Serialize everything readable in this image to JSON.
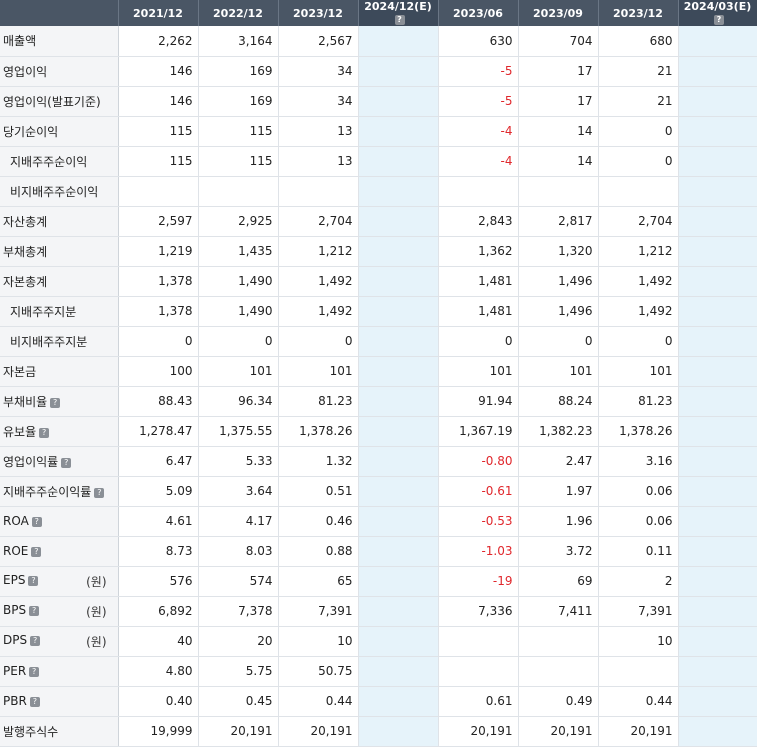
{
  "headers": [
    "",
    "2021/12",
    "2022/12",
    "2023/12",
    "2024/12(E)",
    "2023/06",
    "2023/09",
    "2023/12",
    "2024/03(E)"
  ],
  "estimate_columns": [
    4,
    8
  ],
  "rows": [
    {
      "label": "매출액",
      "help": false,
      "unit": "",
      "sub": false,
      "values": [
        "2,262",
        "3,164",
        "2,567",
        "",
        "630",
        "704",
        "680",
        ""
      ]
    },
    {
      "label": "영업이익",
      "help": false,
      "unit": "",
      "sub": false,
      "values": [
        "146",
        "169",
        "34",
        "",
        "-5",
        "17",
        "21",
        ""
      ]
    },
    {
      "label": "영업이익(발표기준)",
      "help": false,
      "unit": "",
      "sub": false,
      "values": [
        "146",
        "169",
        "34",
        "",
        "-5",
        "17",
        "21",
        ""
      ]
    },
    {
      "label": "당기순이익",
      "help": false,
      "unit": "",
      "sub": false,
      "values": [
        "115",
        "115",
        "13",
        "",
        "-4",
        "14",
        "0",
        ""
      ]
    },
    {
      "label": "지배주주순이익",
      "help": false,
      "unit": "",
      "sub": true,
      "values": [
        "115",
        "115",
        "13",
        "",
        "-4",
        "14",
        "0",
        ""
      ]
    },
    {
      "label": "비지배주주순이익",
      "help": false,
      "unit": "",
      "sub": true,
      "values": [
        "",
        "",
        "",
        "",
        "",
        "",
        "",
        ""
      ]
    },
    {
      "label": "자산총계",
      "help": false,
      "unit": "",
      "sub": false,
      "values": [
        "2,597",
        "2,925",
        "2,704",
        "",
        "2,843",
        "2,817",
        "2,704",
        ""
      ]
    },
    {
      "label": "부채총계",
      "help": false,
      "unit": "",
      "sub": false,
      "values": [
        "1,219",
        "1,435",
        "1,212",
        "",
        "1,362",
        "1,320",
        "1,212",
        ""
      ]
    },
    {
      "label": "자본총계",
      "help": false,
      "unit": "",
      "sub": false,
      "values": [
        "1,378",
        "1,490",
        "1,492",
        "",
        "1,481",
        "1,496",
        "1,492",
        ""
      ]
    },
    {
      "label": "지배주주지분",
      "help": false,
      "unit": "",
      "sub": true,
      "values": [
        "1,378",
        "1,490",
        "1,492",
        "",
        "1,481",
        "1,496",
        "1,492",
        ""
      ]
    },
    {
      "label": "비지배주주지분",
      "help": false,
      "unit": "",
      "sub": true,
      "values": [
        "0",
        "0",
        "0",
        "",
        "0",
        "0",
        "0",
        ""
      ]
    },
    {
      "label": "자본금",
      "help": false,
      "unit": "",
      "sub": false,
      "values": [
        "100",
        "101",
        "101",
        "",
        "101",
        "101",
        "101",
        ""
      ]
    },
    {
      "label": "부채비율",
      "help": true,
      "unit": "",
      "sub": false,
      "values": [
        "88.43",
        "96.34",
        "81.23",
        "",
        "91.94",
        "88.24",
        "81.23",
        ""
      ]
    },
    {
      "label": "유보율",
      "help": true,
      "unit": "",
      "sub": false,
      "values": [
        "1,278.47",
        "1,375.55",
        "1,378.26",
        "",
        "1,367.19",
        "1,382.23",
        "1,378.26",
        ""
      ]
    },
    {
      "label": "영업이익률",
      "help": true,
      "unit": "",
      "sub": false,
      "values": [
        "6.47",
        "5.33",
        "1.32",
        "",
        "-0.80",
        "2.47",
        "3.16",
        ""
      ]
    },
    {
      "label": "지배주주순이익률",
      "help": true,
      "unit": "",
      "sub": false,
      "values": [
        "5.09",
        "3.64",
        "0.51",
        "",
        "-0.61",
        "1.97",
        "0.06",
        ""
      ]
    },
    {
      "label": "ROA",
      "help": true,
      "unit": "",
      "sub": false,
      "values": [
        "4.61",
        "4.17",
        "0.46",
        "",
        "-0.53",
        "1.96",
        "0.06",
        ""
      ]
    },
    {
      "label": "ROE",
      "help": true,
      "unit": "",
      "sub": false,
      "values": [
        "8.73",
        "8.03",
        "0.88",
        "",
        "-1.03",
        "3.72",
        "0.11",
        ""
      ]
    },
    {
      "label": "EPS",
      "help": true,
      "unit": "(원)",
      "sub": false,
      "values": [
        "576",
        "574",
        "65",
        "",
        "-19",
        "69",
        "2",
        ""
      ]
    },
    {
      "label": "BPS",
      "help": true,
      "unit": "(원)",
      "sub": false,
      "values": [
        "6,892",
        "7,378",
        "7,391",
        "",
        "7,336",
        "7,411",
        "7,391",
        ""
      ]
    },
    {
      "label": "DPS",
      "help": true,
      "unit": "(원)",
      "sub": false,
      "values": [
        "40",
        "20",
        "10",
        "",
        "",
        "",
        "10",
        ""
      ]
    },
    {
      "label": "PER",
      "help": true,
      "unit": "",
      "sub": false,
      "values": [
        "4.80",
        "5.75",
        "50.75",
        "",
        "",
        "",
        "",
        ""
      ]
    },
    {
      "label": "PBR",
      "help": true,
      "unit": "",
      "sub": false,
      "values": [
        "0.40",
        "0.45",
        "0.44",
        "",
        "0.61",
        "0.49",
        "0.44",
        ""
      ]
    },
    {
      "label": "발행주식수",
      "help": false,
      "unit": "",
      "sub": false,
      "values": [
        "19,999",
        "20,191",
        "20,191",
        "",
        "20,191",
        "20,191",
        "20,191",
        ""
      ]
    }
  ]
}
